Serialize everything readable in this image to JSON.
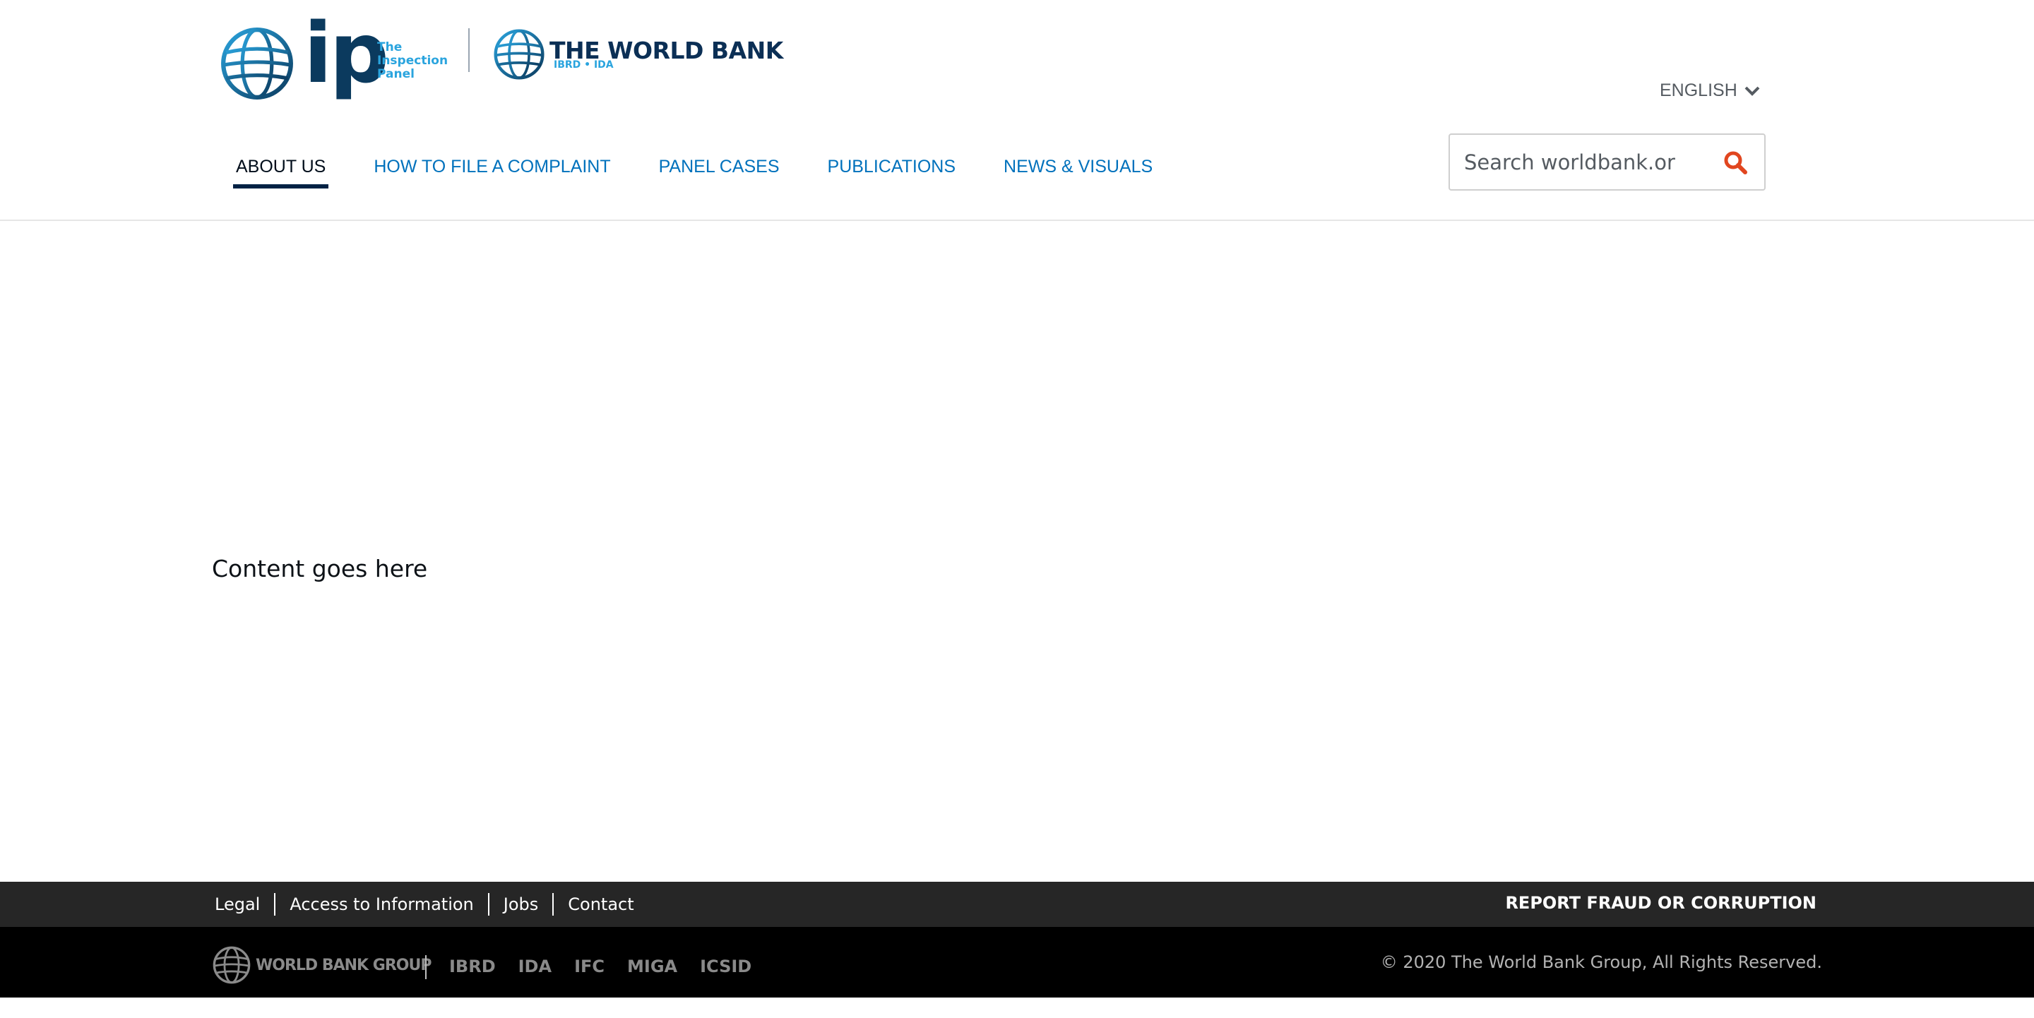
{
  "brand": {
    "ip_logo_text": "ip",
    "ip_subtitle": [
      "The",
      "Inspection",
      "Panel"
    ],
    "worldbank_title": "THE WORLD BANK",
    "worldbank_subtitle": "IBRD • IDA"
  },
  "language": {
    "label": "ENGLISH",
    "icon": "chevron-down-icon"
  },
  "nav": {
    "items": [
      {
        "label": "ABOUT US",
        "active": true
      },
      {
        "label": "HOW TO FILE A COMPLAINT",
        "active": false
      },
      {
        "label": "PANEL CASES",
        "active": false
      },
      {
        "label": "PUBLICATIONS",
        "active": false
      },
      {
        "label": "NEWS & VISUALS",
        "active": false
      }
    ]
  },
  "search": {
    "placeholder": "Search worldbank.org",
    "icon": "search-icon"
  },
  "main": {
    "content_text": "Content goes here"
  },
  "footer": {
    "links": [
      "Legal",
      "Access to Information",
      "Jobs",
      "Contact"
    ],
    "report_label": "REPORT FRAUD OR CORRUPTION",
    "group_logo_text": "WORLD BANK GROUP",
    "orgs": [
      "IBRD",
      "IDA",
      "IFC",
      "MIGA",
      "ICSID"
    ],
    "copyright": "© 2020 The World Bank Group, All Rights Reserved."
  },
  "colors": {
    "nav_link": "#0071bc",
    "nav_active": "#002244",
    "search_icon": "#e1461f",
    "footer_top_bg": "#262626",
    "footer_bottom_bg": "#000000",
    "brand_light_blue": "#2aa4de",
    "brand_dark_blue": "#0b2f55"
  }
}
